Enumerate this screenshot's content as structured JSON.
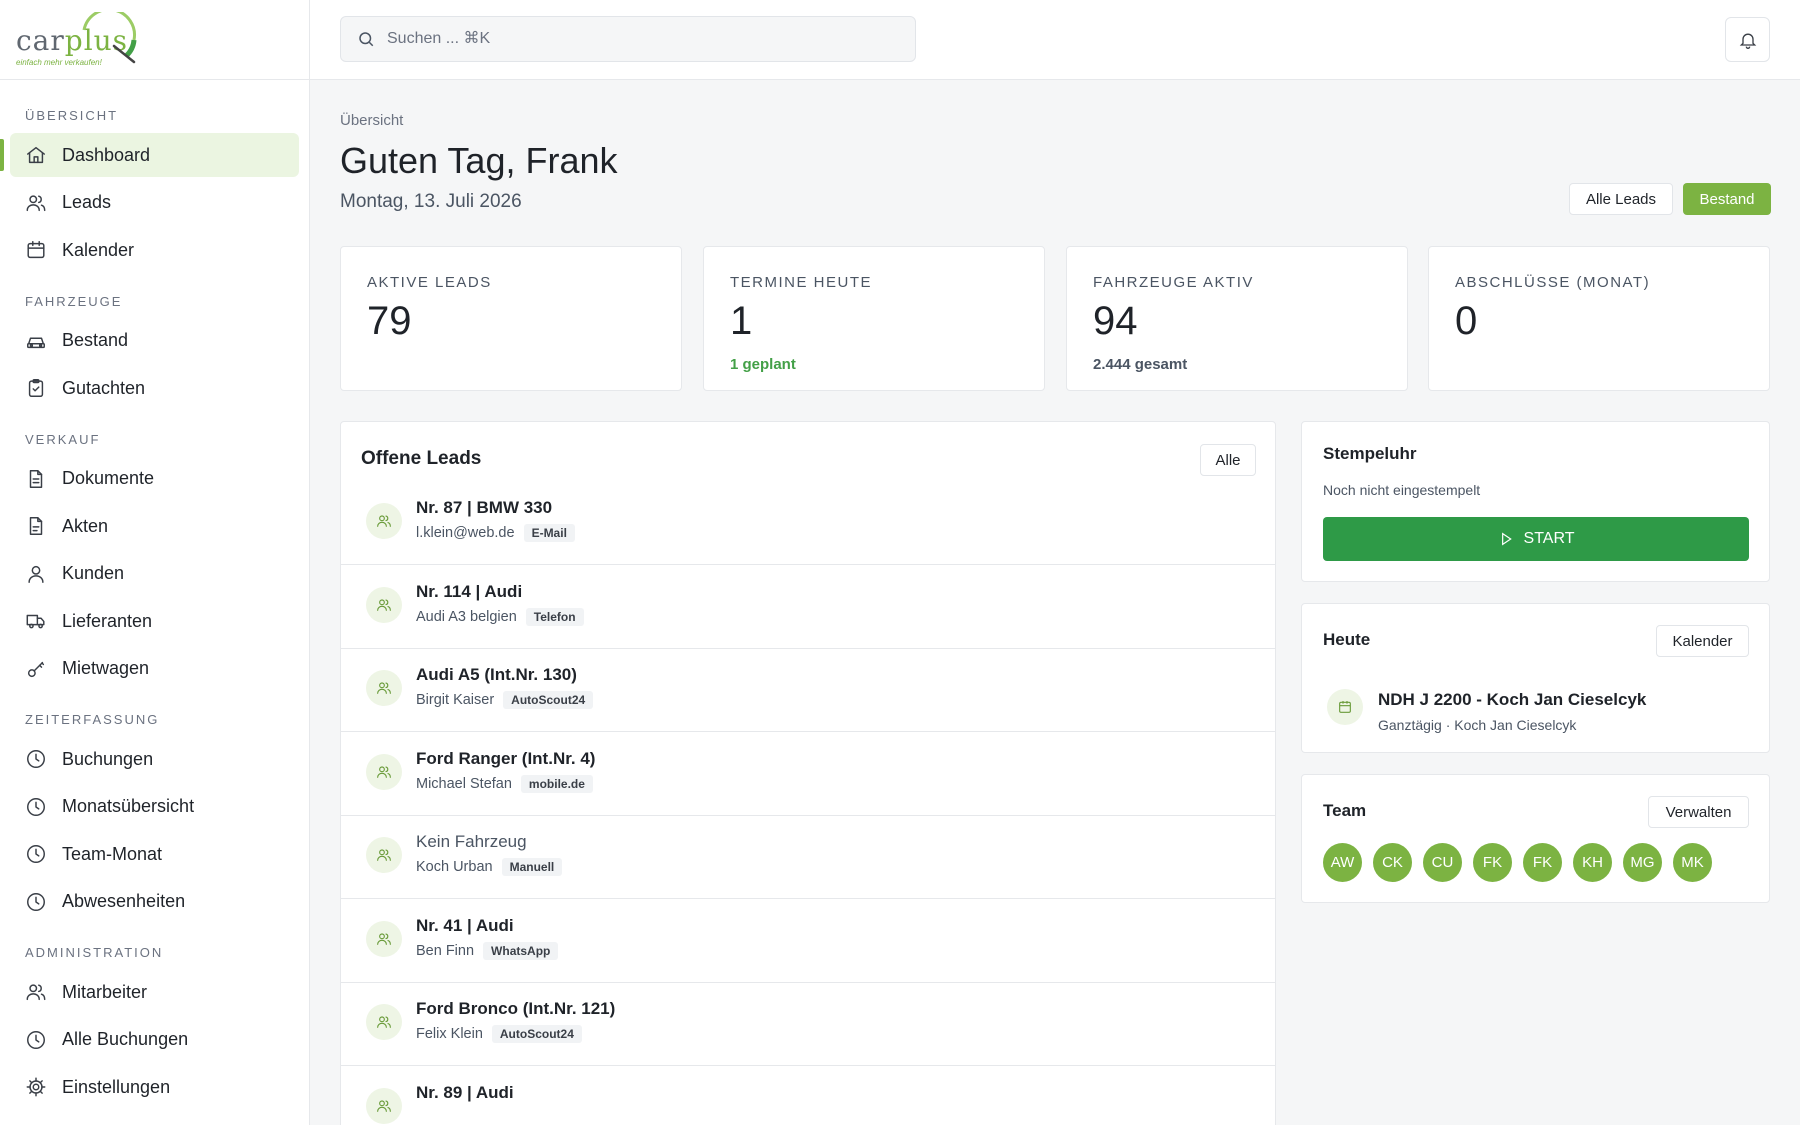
{
  "brand": {
    "name_part1": "car",
    "name_part2": "plus",
    "tagline": "einfach mehr verkaufen!"
  },
  "colors": {
    "accent": "#7cb342",
    "start_button": "#2e9a47",
    "positive_text": "#43a047"
  },
  "search": {
    "placeholder": "Suchen ... ⌘K",
    "icon": "search-icon"
  },
  "notifications": {
    "icon": "bell-icon"
  },
  "sidebar": {
    "sections": [
      {
        "title": "ÜBERSICHT",
        "items": [
          {
            "label": "Dashboard",
            "icon": "home-icon",
            "active": true
          },
          {
            "label": "Leads",
            "icon": "users-icon"
          },
          {
            "label": "Kalender",
            "icon": "calendar-icon"
          }
        ]
      },
      {
        "title": "FAHRZEUGE",
        "items": [
          {
            "label": "Bestand",
            "icon": "car-icon"
          },
          {
            "label": "Gutachten",
            "icon": "clipboard-check-icon"
          }
        ]
      },
      {
        "title": "VERKAUF",
        "items": [
          {
            "label": "Dokumente",
            "icon": "document-icon"
          },
          {
            "label": "Akten",
            "icon": "file-icon"
          },
          {
            "label": "Kunden",
            "icon": "user-icon"
          },
          {
            "label": "Lieferanten",
            "icon": "truck-icon"
          },
          {
            "label": "Mietwagen",
            "icon": "key-icon"
          }
        ]
      },
      {
        "title": "ZEITERFASSUNG",
        "items": [
          {
            "label": "Buchungen",
            "icon": "clock-icon"
          },
          {
            "label": "Monatsübersicht",
            "icon": "clock-icon"
          },
          {
            "label": "Team-Monat",
            "icon": "clock-icon"
          },
          {
            "label": "Abwesenheiten",
            "icon": "clock-icon"
          }
        ]
      },
      {
        "title": "ADMINISTRATION",
        "items": [
          {
            "label": "Mitarbeiter",
            "icon": "users-icon"
          },
          {
            "label": "Alle Buchungen",
            "icon": "clock-icon"
          },
          {
            "label": "Einstellungen",
            "icon": "gear-icon"
          }
        ]
      }
    ]
  },
  "header": {
    "breadcrumb": "Übersicht",
    "greeting": "Guten Tag, Frank",
    "date": "Montag, 13. Juli 2026",
    "all_leads_label": "Alle Leads",
    "stock_label": "Bestand"
  },
  "stats": [
    {
      "label": "AKTIVE LEADS",
      "value": "79",
      "sub": ""
    },
    {
      "label": "TERMINE HEUTE",
      "value": "1",
      "sub": "1 geplant"
    },
    {
      "label": "FAHRZEUGE AKTIV",
      "value": "94",
      "sub": "2.444 gesamt"
    },
    {
      "label": "ABSCHLÜSSE (MONAT)",
      "value": "0",
      "sub": ""
    }
  ],
  "leads": {
    "title": "Offene Leads",
    "all_label": "Alle",
    "items": [
      {
        "title": "Nr. 87 | BMW 330",
        "sub": "l.klein@web.de",
        "tag": "E-Mail"
      },
      {
        "title": "Nr. 114 | Audi",
        "sub": "Audi A3 belgien",
        "tag": "Telefon"
      },
      {
        "title": "Audi A5 (Int.Nr. 130)",
        "sub": "Birgit Kaiser",
        "tag": "AutoScout24"
      },
      {
        "title": "Ford Ranger (Int.Nr. 4)",
        "sub": "Michael Stefan",
        "tag": "mobile.de"
      },
      {
        "title": "Kein Fahrzeug",
        "sub": "Koch Urban",
        "tag": "Manuell"
      },
      {
        "title": "Nr. 41 | Audi",
        "sub": "Ben Finn",
        "tag": "WhatsApp"
      },
      {
        "title": "Ford Bronco (Int.Nr. 121)",
        "sub": "Felix Klein",
        "tag": "AutoScout24"
      },
      {
        "title": "Nr. 89 | Audi",
        "sub": "",
        "tag": ""
      }
    ]
  },
  "stempeluhr": {
    "title": "Stempeluhr",
    "status": "Noch nicht eingestempelt",
    "start_label": "START"
  },
  "today": {
    "title": "Heute",
    "calendar_label": "Kalender",
    "event_title": "NDH J 2200 - Koch Jan Cieselcyk",
    "event_sub": "Ganztägig · Koch Jan Cieselcyk"
  },
  "team": {
    "title": "Team",
    "manage_label": "Verwalten",
    "members": [
      "AW",
      "CK",
      "CU",
      "FK",
      "FK",
      "KH",
      "MG",
      "MK"
    ]
  }
}
